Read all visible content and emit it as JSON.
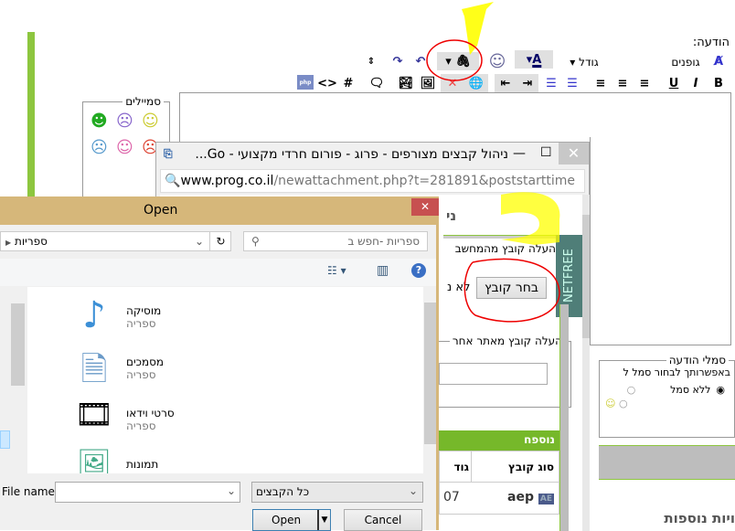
{
  "editor": {
    "message_label": "הודעה:",
    "fonts_label": "גופנים",
    "size_label": "גודל",
    "bold": "B",
    "italic": "I",
    "underline": "U",
    "hash": "#",
    "code": "<>",
    "php": "php"
  },
  "smilies": {
    "legend": "סמיילים"
  },
  "post_icons": {
    "legend": "סמלי הודעה",
    "hint": "באפשרותך לבחור סמל ל",
    "no_icon": "ללא סמל"
  },
  "more_options": "ויות נוספות",
  "popup": {
    "title": "ניהול קבצים מצורפים - פרוג - פורום חרדי מקצועי - Go...",
    "url_host": "www.prog.co.il",
    "url_path": "/newattachment.php?t=281891&poststarttime",
    "heading": "ני",
    "upload_local": "העלה קובץ מהמחשב",
    "choose_file": "בחר קובץ",
    "no_file": "לא נ",
    "netfree": "NETFREE",
    "upload_url_legend": "העלה קובץ מאתר אחר",
    "table_title": "נוספח",
    "col_type": "סוג קובץ",
    "col_size": "גוד",
    "rows": [
      {
        "type": "aep",
        "size": "07"
      }
    ]
  },
  "dialog": {
    "title": "Open",
    "breadcrumb": "ספריות",
    "search_placeholder": "ספריות -חפש ב",
    "libraries": [
      {
        "name": "מוסיקה",
        "kind": "ספריה"
      },
      {
        "name": "מסמכים",
        "kind": "ספריה"
      },
      {
        "name": "סרטי וידאו",
        "kind": "ספריה"
      },
      {
        "name": "תמונות",
        "kind": "ספריה"
      }
    ],
    "file_name_label": "File name:",
    "file_name_value": "",
    "filter": "כל הקבצים",
    "open": "Open",
    "cancel": "Cancel"
  }
}
